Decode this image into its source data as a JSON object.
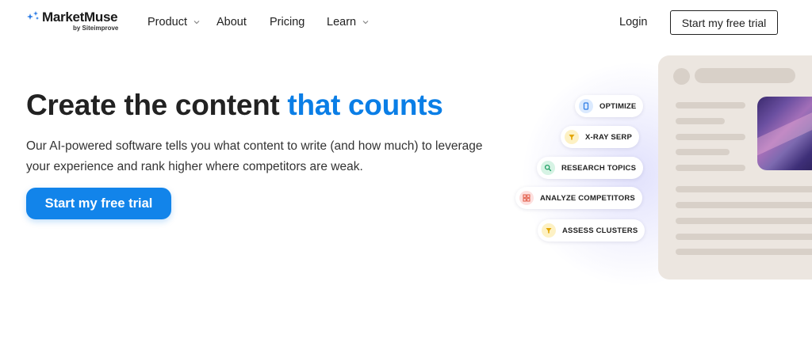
{
  "brand": {
    "name": "MarketMuse",
    "byline": "by Siteimprove",
    "logo_icon": "sparkle-icon",
    "accent_color": "#0a7ee6"
  },
  "nav": {
    "items": [
      {
        "label": "Product",
        "has_dropdown": true
      },
      {
        "label": "About",
        "has_dropdown": false
      },
      {
        "label": "Pricing",
        "has_dropdown": false
      },
      {
        "label": "Learn",
        "has_dropdown": true
      }
    ],
    "login_label": "Login",
    "cta_label": "Start my free trial"
  },
  "hero": {
    "headline_plain": "Create the content ",
    "headline_accent": "that counts",
    "subtext": "Our AI-powered software tells you what content to write (and how much) to leverage your experience and rank higher where competitors are weak.",
    "cta_label": "Start my free trial",
    "cta_color": "#1284ea"
  },
  "illustration": {
    "features": [
      {
        "label": "OPTIMIZE",
        "icon": "document-icon",
        "tone": "blue"
      },
      {
        "label": "X-RAY SERP",
        "icon": "funnel-icon",
        "tone": "yellow"
      },
      {
        "label": "RESEARCH TOPICS",
        "icon": "magnifier-icon",
        "tone": "green"
      },
      {
        "label": "ANALYZE COMPETITORS",
        "icon": "grid-icon",
        "tone": "red"
      },
      {
        "label": "ASSESS CLUSTERS",
        "icon": "cluster-icon",
        "tone": "yellow"
      }
    ]
  }
}
